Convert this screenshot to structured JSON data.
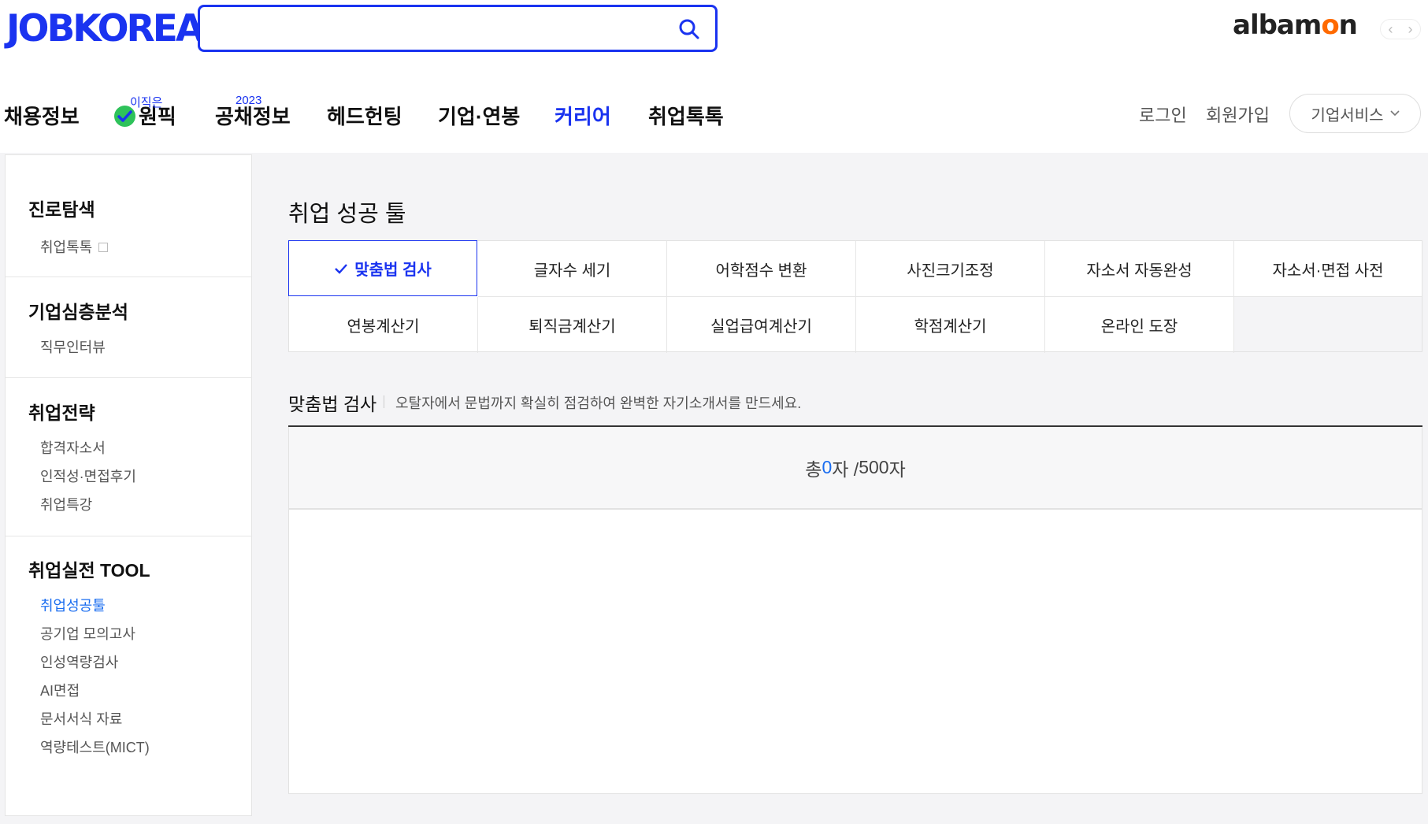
{
  "header": {
    "logo_text": "JOBKOREA",
    "search": {
      "value": "",
      "placeholder": ""
    },
    "partner_logo_main": "albam",
    "partner_logo_accent": "o",
    "partner_logo_tail": "n",
    "gnb": [
      {
        "label": "채용정보"
      },
      {
        "label": "원픽",
        "sup": "이직은"
      },
      {
        "label": "공채정보",
        "sup": "2023"
      },
      {
        "label": "헤드헌팅"
      },
      {
        "label": "기업·연봉"
      },
      {
        "label": "커리어",
        "active": true
      },
      {
        "label": "취업톡톡"
      }
    ],
    "login": "로그인",
    "signup": "회원가입",
    "business": "기업서비스"
  },
  "sidebar": {
    "groups": [
      {
        "title": "진로탐색",
        "links": [
          "취업톡톡"
        ]
      },
      {
        "title": "기업심층분석",
        "links": [
          "직무인터뷰"
        ]
      },
      {
        "title": "취업전략",
        "links": [
          "합격자소서",
          "인적성·면접후기",
          "취업특강"
        ]
      },
      {
        "title": "취업실전 TOOL",
        "links": [
          "취업성공툴",
          "공기업 모의고사",
          "인성역량검사",
          "AI면접",
          "문서서식 자료",
          "역량테스트(MICT)"
        ],
        "active_index": 0
      }
    ]
  },
  "main": {
    "title": "취업 성공 툴",
    "tabs": [
      "맞춤법 검사",
      "글자수 세기",
      "어학점수 변환",
      "사진크기조정",
      "자소서 자동완성",
      "자소서·면접 사전",
      "연봉계산기",
      "퇴직금계산기",
      "실업급여계산기",
      "학점계산기",
      "온라인 도장"
    ],
    "selected_tab": 0,
    "section_title": "맞춤법 검사",
    "section_desc": "오탈자에서 문법까지 확실히 점검하여 완벽한 자기소개서를 만드세요.",
    "counter": {
      "prefix": "총 ",
      "count": "0",
      "mid": "자 / ",
      "max": "500",
      "suffix": "자"
    },
    "editor": {
      "value": "",
      "placeholder": ""
    }
  },
  "colors": {
    "brand": "#1a33f0",
    "logo_highlight": "#b8f42c",
    "accent_blue": "#1a6df0",
    "check_green": "#2ec25a",
    "albamon_orange": "#ff6a00"
  }
}
